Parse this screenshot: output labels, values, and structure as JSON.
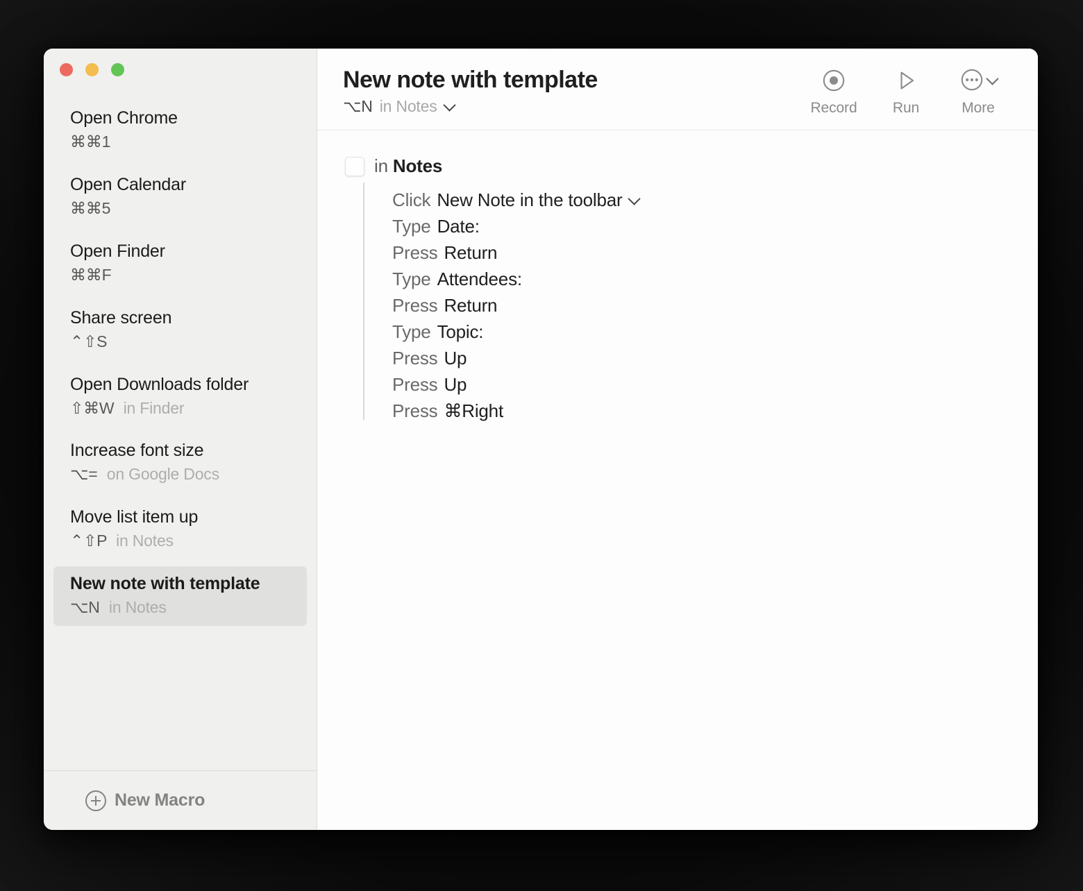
{
  "window": {
    "traffic_lights": {
      "close_color": "#ED6A5E",
      "minimize_color": "#F4BD4F",
      "maximize_color": "#61C454"
    }
  },
  "sidebar": {
    "macros": [
      {
        "title": "Open Chrome",
        "keys": "⌘⌘1",
        "scope": ""
      },
      {
        "title": "Open Calendar",
        "keys": "⌘⌘5",
        "scope": ""
      },
      {
        "title": "Open Finder",
        "keys": "⌘⌘F",
        "scope": ""
      },
      {
        "title": "Share screen",
        "keys": "⌃⇧S",
        "scope": ""
      },
      {
        "title": "Open Downloads folder",
        "keys": "⇧⌘W",
        "scope": "in Finder"
      },
      {
        "title": "Increase font size",
        "keys": "⌥=",
        "scope": "on Google Docs"
      },
      {
        "title": "Move list item up",
        "keys": "⌃⇧P",
        "scope": "in Notes"
      },
      {
        "title": "New note with template",
        "keys": "⌥N",
        "scope": "in Notes",
        "selected": true
      }
    ],
    "footer": {
      "new_macro_label": "New Macro",
      "new_macro_icon": "plus-circle-icon"
    }
  },
  "toolbar": {
    "title": "New note with template",
    "subtitle_keys": "⌥N",
    "subtitle_scope": "in Notes",
    "subtitle_chevron_icon": "chevron-down-icon",
    "actions": [
      {
        "label": "Record",
        "icon": "record-icon"
      },
      {
        "label": "Run",
        "icon": "play-icon"
      },
      {
        "label": "More",
        "icon": "ellipsis-circle-icon"
      }
    ]
  },
  "editor": {
    "app_context": {
      "preposition": "in",
      "app_name": "Notes",
      "app_icon": "notes-app-icon"
    },
    "steps": [
      {
        "verb": "Click",
        "arg": "New Note in the toolbar",
        "chevron": true
      },
      {
        "verb": "Type",
        "arg": "Date:",
        "chevron": false
      },
      {
        "verb": "Press",
        "arg": "Return",
        "chevron": false
      },
      {
        "verb": "Type",
        "arg": "Attendees:",
        "chevron": false
      },
      {
        "verb": "Press",
        "arg": "Return",
        "chevron": false
      },
      {
        "verb": "Type",
        "arg": "Topic:",
        "chevron": false
      },
      {
        "verb": "Press",
        "arg": "Up",
        "chevron": false
      },
      {
        "verb": "Press",
        "arg": "Up",
        "chevron": false
      },
      {
        "verb": "Press",
        "arg": "⌘Right",
        "chevron": false
      }
    ]
  }
}
